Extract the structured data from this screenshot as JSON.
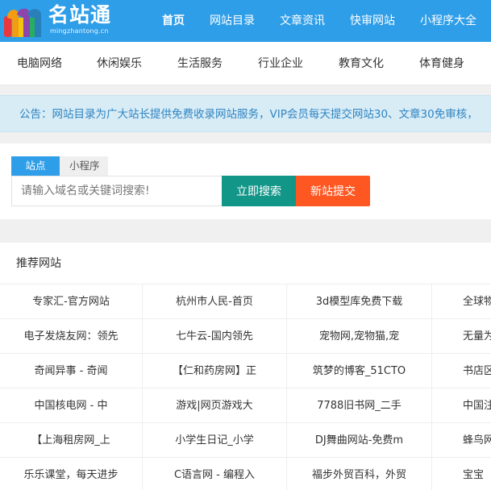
{
  "header": {
    "logo_text": "名站通",
    "logo_sub": "mingzhantong.cn",
    "nav": [
      "首页",
      "网站目录",
      "文章资讯",
      "快审网站",
      "小程序大全"
    ],
    "active_index": 0
  },
  "categories": [
    "电脑网络",
    "休闲娱乐",
    "生活服务",
    "行业企业",
    "教育文化",
    "体育健身"
  ],
  "notice": "公告：网站目录为广大站长提供免费收录网站服务，VIP会员每天提交网站30、文章30免审核，",
  "search": {
    "tabs": [
      "站点",
      "小程序"
    ],
    "placeholder": "请输入域名或关键词搜索!",
    "search_button": "立即搜索",
    "submit_button": "新站提交"
  },
  "recommended": {
    "title": "推荐网站",
    "rows": [
      [
        "专家汇-官方网站",
        "杭州市人民-首页",
        "3d模型库免费下载",
        "全球物"
      ],
      [
        "电子发烧友网：领先",
        "七牛云-国内领先",
        "宠物网,宠物猫,宠",
        "无量为"
      ],
      [
        "奇闻异事 - 奇闻",
        "【仁和药房网】正",
        "筑梦的博客_51CTO",
        "书店区"
      ],
      [
        "中国核电网 - 中",
        "游戏|网页游戏大",
        "7788旧书网_二手",
        "中国注"
      ],
      [
        "【上海租房网_上",
        "小学生日记_小学",
        "DJ舞曲网站-免费m",
        "蜂鸟网"
      ],
      [
        "乐乐课堂，每天进步",
        "C语言网 - 编程入",
        "福步外贸百科，外贸",
        "宝宝"
      ]
    ]
  },
  "colors": {
    "header_bg": "#2f9ee8",
    "notice_bg": "#d8ecf6",
    "notice_text": "#2f84c1",
    "search_btn": "#129688",
    "submit_btn": "#ff5722"
  }
}
